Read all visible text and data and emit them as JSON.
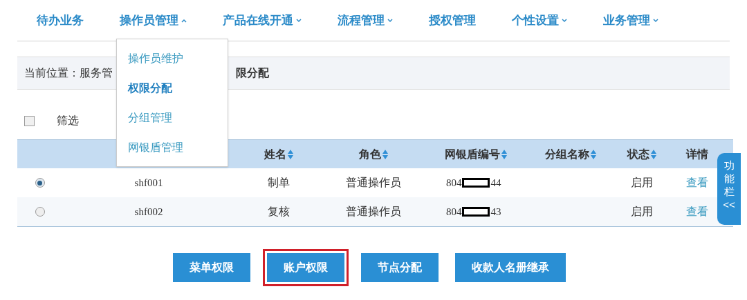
{
  "nav": [
    {
      "label": "待办业务",
      "kind": "link"
    },
    {
      "label": "操作员管理",
      "kind": "menu",
      "expanded": true
    },
    {
      "label": "产品在线开通",
      "kind": "menu",
      "expanded": false
    },
    {
      "label": "流程管理",
      "kind": "menu",
      "expanded": false
    },
    {
      "label": "授权管理",
      "kind": "link"
    },
    {
      "label": "个性设置",
      "kind": "menu",
      "expanded": false
    },
    {
      "label": "业务管理",
      "kind": "menu",
      "expanded": false
    }
  ],
  "dropdown": [
    {
      "label": "操作员维护",
      "selected": false
    },
    {
      "label": "权限分配",
      "selected": true
    },
    {
      "label": "分组管理",
      "selected": false
    },
    {
      "label": "网银盾管理",
      "selected": false
    }
  ],
  "breadcrumb": {
    "prefix": "当前位置：服务管",
    "current": "限分配"
  },
  "filter": {
    "label": "筛选",
    "checked": false
  },
  "table": {
    "columns": [
      {
        "label": "姓名",
        "sortable": true
      },
      {
        "label": "角色",
        "sortable": true
      },
      {
        "label": "网银盾编号",
        "sortable": true
      },
      {
        "label": "分组名称",
        "sortable": true
      },
      {
        "label": "状态",
        "sortable": true
      },
      {
        "label": "详情",
        "sortable": false
      }
    ],
    "rows": [
      {
        "selected": true,
        "account": "shf001",
        "name": "制单",
        "role": "普通操作员",
        "shield_prefix": "804",
        "redacted": true,
        "shield_suffix": "44",
        "status": "启用",
        "detail": "查看"
      },
      {
        "selected": false,
        "account": "shf002",
        "name": "复核",
        "role": "普通操作员",
        "shield_prefix": "804",
        "redacted": true,
        "shield_suffix": "43",
        "status": "启用",
        "detail": "查看"
      }
    ]
  },
  "side_tab": {
    "label": "功能栏",
    "arrow": "<<"
  },
  "buttons": [
    {
      "label": "菜单权限",
      "highlighted": false
    },
    {
      "label": "账户权限",
      "highlighted": true
    },
    {
      "label": "节点分配",
      "highlighted": false
    },
    {
      "label": "收款人名册继承",
      "highlighted": false
    }
  ]
}
